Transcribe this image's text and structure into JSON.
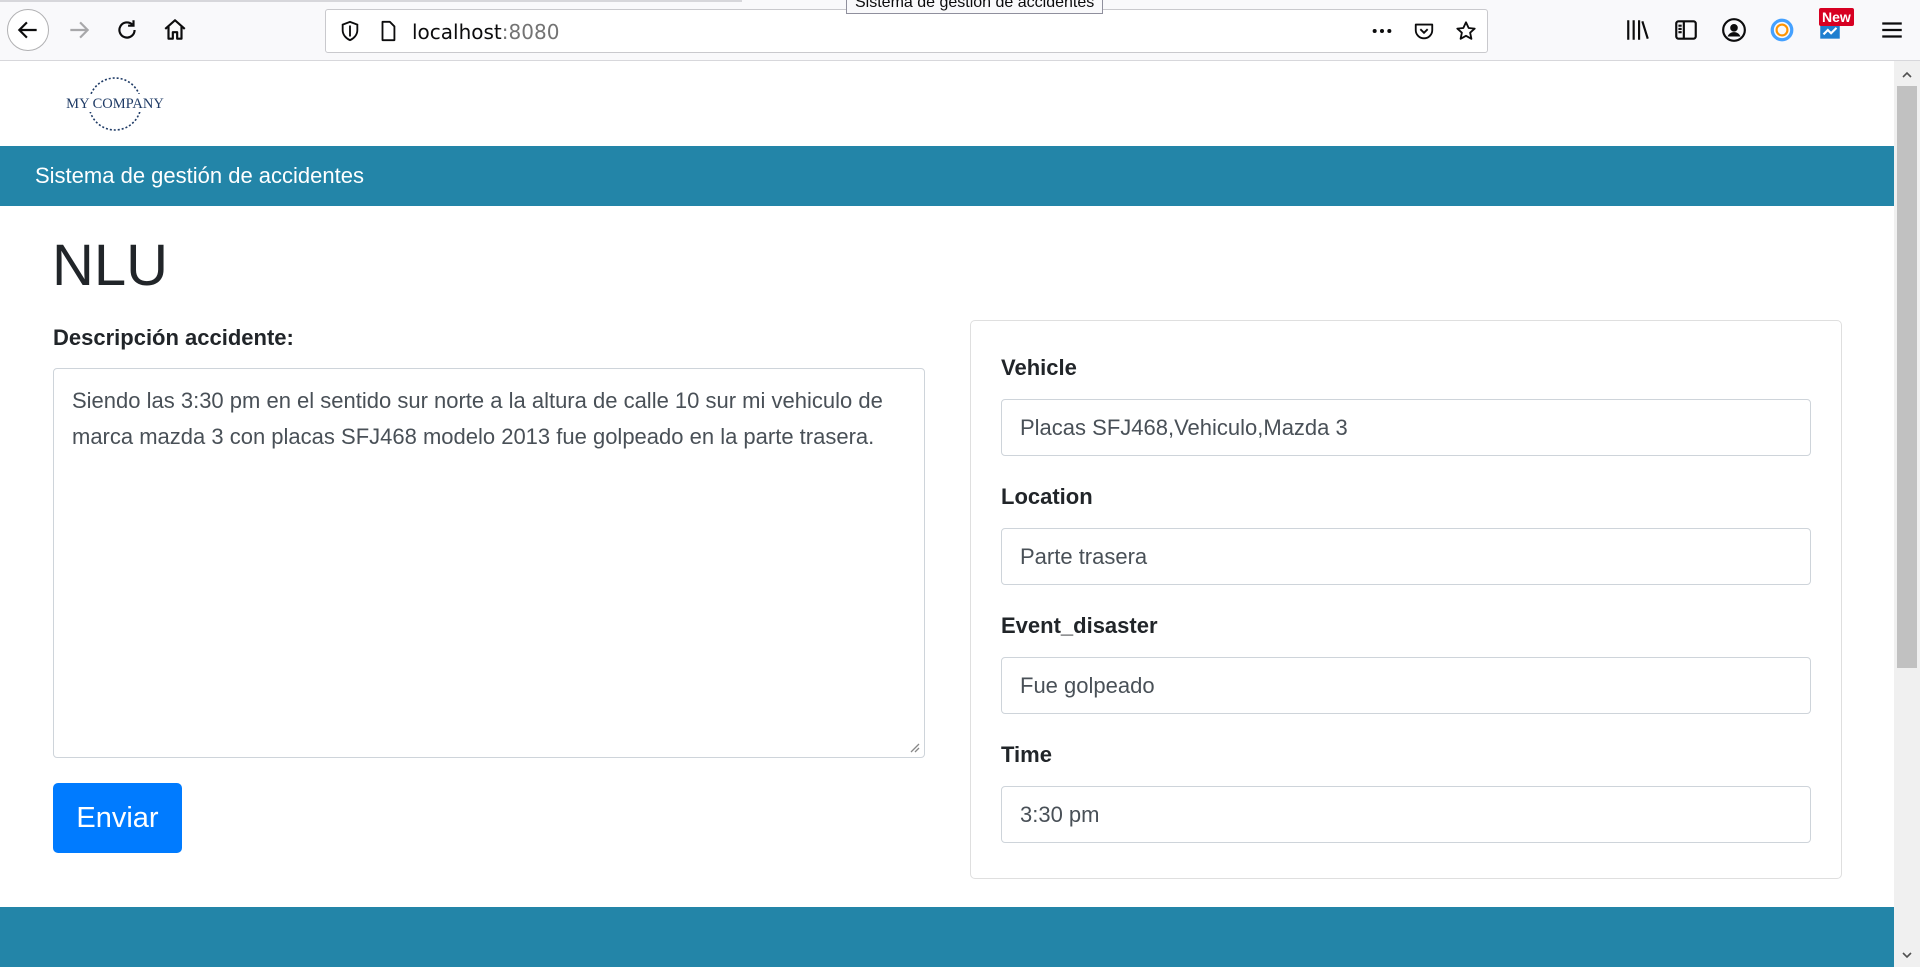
{
  "browser": {
    "tab_tooltip": "Sistema de gestión de accidentes",
    "url_host": "localhost",
    "url_port": ":8080",
    "new_badge": "New",
    "icons": [
      "back-icon",
      "forward-icon",
      "reload-icon",
      "home-icon",
      "shield-icon",
      "page-icon",
      "more-icon",
      "pocket-icon",
      "star-icon",
      "library-icon",
      "sidebar-icon",
      "account-icon",
      "extension-icon",
      "screenshot-icon",
      "menu-icon"
    ]
  },
  "header": {
    "logo_text": "MY COMPANY",
    "banner_title": "Sistema de gestión de accidentes"
  },
  "main": {
    "title": "NLU",
    "description_label": "Descripción accidente:",
    "description_value": "Siendo las 3:30 pm en el sentido sur norte a la altura de calle 10 sur mi vehiculo de marca mazda 3 con placas SFJ468 modelo 2013 fue golpeado en la parte trasera.",
    "submit_label": "Enviar"
  },
  "results": {
    "fields": [
      {
        "label": "Vehicle",
        "value": "Placas SFJ468,Vehiculo,Mazda 3"
      },
      {
        "label": "Location",
        "value": "Parte trasera"
      },
      {
        "label": "Event_disaster",
        "value": "Fue golpeado"
      },
      {
        "label": "Time",
        "value": "3:30 pm"
      }
    ]
  },
  "colors": {
    "brand_bar": "#2385a8",
    "primary_button": "#007bff"
  }
}
